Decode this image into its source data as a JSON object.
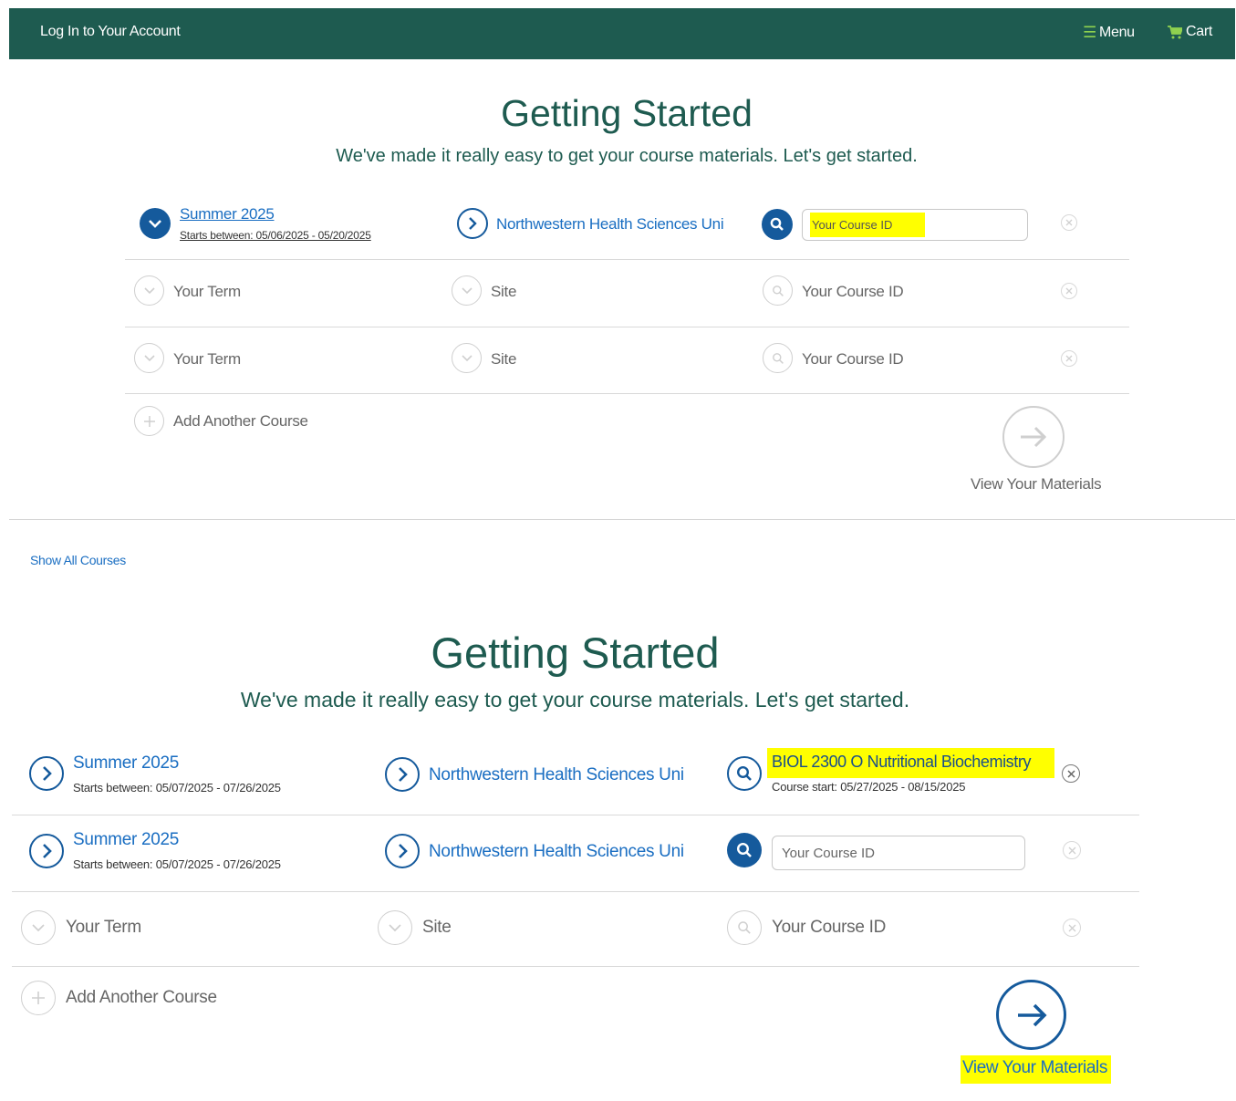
{
  "nav": {
    "login": "Log In to Your Account",
    "menu": "Menu",
    "cart": "Cart"
  },
  "top": {
    "title": "Getting Started",
    "subtitle": "We've made it really easy to get your course materials. Let's get started.",
    "row1": {
      "term": "Summer 2025",
      "dates": "Starts between: 05/06/2025 - 05/20/2025",
      "site": "Northwestern Health Sciences Uni",
      "course_placeholder": "Your Course ID"
    },
    "row2": {
      "term": "Your Term",
      "site": "Site",
      "course": "Your Course ID"
    },
    "row3": {
      "term": "Your Term",
      "site": "Site",
      "course": "Your Course ID"
    },
    "add_course": "Add Another Course",
    "view_materials": "View Your Materials"
  },
  "show_all": "Show All Courses",
  "bottom": {
    "title": "Getting Started",
    "subtitle": "We've made it really easy to get your course materials. Let's get started.",
    "row1": {
      "term": "Summer 2025",
      "dates": "Starts between: 05/07/2025 - 07/26/2025",
      "site": "Northwestern Health Sciences Uni",
      "course": "BIOL 2300 O Nutritional Biochemistry",
      "course_dates": "Course start: 05/27/2025 - 08/15/2025"
    },
    "row2": {
      "term": "Summer 2025",
      "dates": "Starts between: 05/07/2025 - 07/26/2025",
      "site": "Northwestern Health Sciences Uni",
      "course_placeholder": "Your Course ID"
    },
    "row3": {
      "term": "Your Term",
      "site": "Site",
      "course": "Your Course ID"
    },
    "add_course": "Add Another Course",
    "view_materials": "View Your Materials"
  }
}
